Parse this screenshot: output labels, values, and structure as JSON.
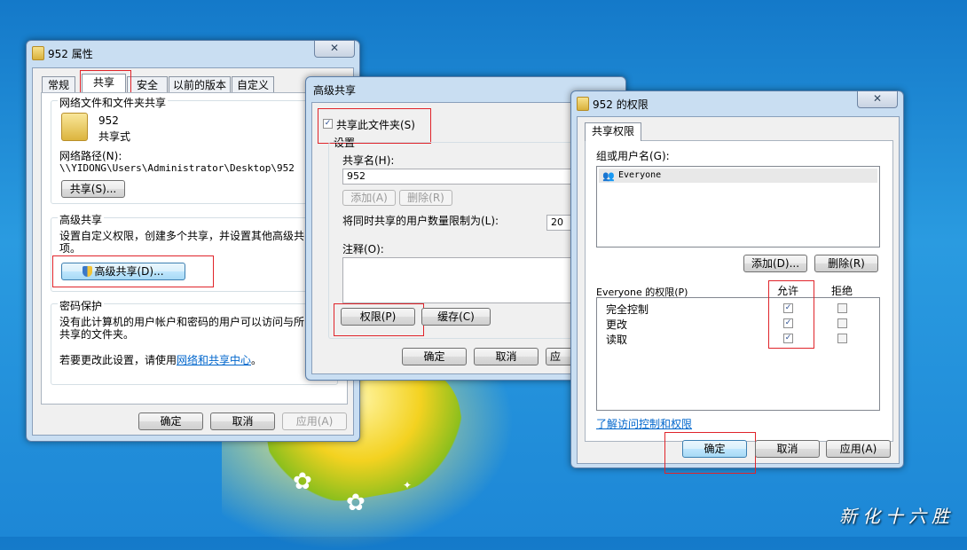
{
  "props_window": {
    "title": "952 属性",
    "close": "✕",
    "tabs": [
      "常规",
      "共享",
      "安全",
      "以前的版本",
      "自定义"
    ],
    "network_section": "网络文件和文件夹共享",
    "folder_name": "952",
    "folder_status": "共享式",
    "path_label": "网络路径(N):",
    "path_value": "\\\\YIDONG\\Users\\Administrator\\Desktop\\952",
    "share_button": "共享(S)...",
    "advanced_section": "高级共享",
    "advanced_desc_1": "设置自定义权限，创建多个共享，并设置其他高级共",
    "advanced_desc_2": "项。",
    "advanced_button": "高级共享(D)...",
    "password_section": "密码保护",
    "password_desc_1": "没有此计算机的用户帐户和密码的用户可以访问与所",
    "password_desc_2": "共享的文件夹。",
    "change_prefix": "若要更改此设置，请使用",
    "change_link": "网络和共享中心",
    "change_suffix": "。",
    "ok": "确定",
    "cancel": "取消",
    "apply": "应用(A)"
  },
  "adv_window": {
    "title": "高级共享",
    "share_checkbox": "共享此文件夹(S)",
    "settings": "设置",
    "share_name_label": "共享名(H):",
    "share_name_value": "952",
    "add": "添加(A)",
    "remove": "删除(R)",
    "limit_label": "将同时共享的用户数量限制为(L):",
    "limit_value": "20",
    "comment_label": "注释(O):",
    "permissions": "权限(P)",
    "cache": "缓存(C)",
    "ok": "确定",
    "cancel": "取消",
    "apply_partial": "应"
  },
  "perm_window": {
    "title": "952 的权限",
    "close": "✕",
    "tab": "共享权限",
    "group_label": "组或用户名(G):",
    "user": "Everyone",
    "add": "添加(D)...",
    "remove": "删除(R)",
    "perm_label": "Everyone 的权限(P)",
    "allow": "允许",
    "deny": "拒绝",
    "rows": [
      {
        "name": "完全控制",
        "allow": true,
        "deny": false
      },
      {
        "name": "更改",
        "allow": true,
        "deny": false
      },
      {
        "name": "读取",
        "allow": true,
        "deny": false
      }
    ],
    "learn_link": "了解访问控制和权限",
    "ok": "确定",
    "cancel": "取消",
    "apply": "应用(A)"
  },
  "watermark": "新化十六胜"
}
